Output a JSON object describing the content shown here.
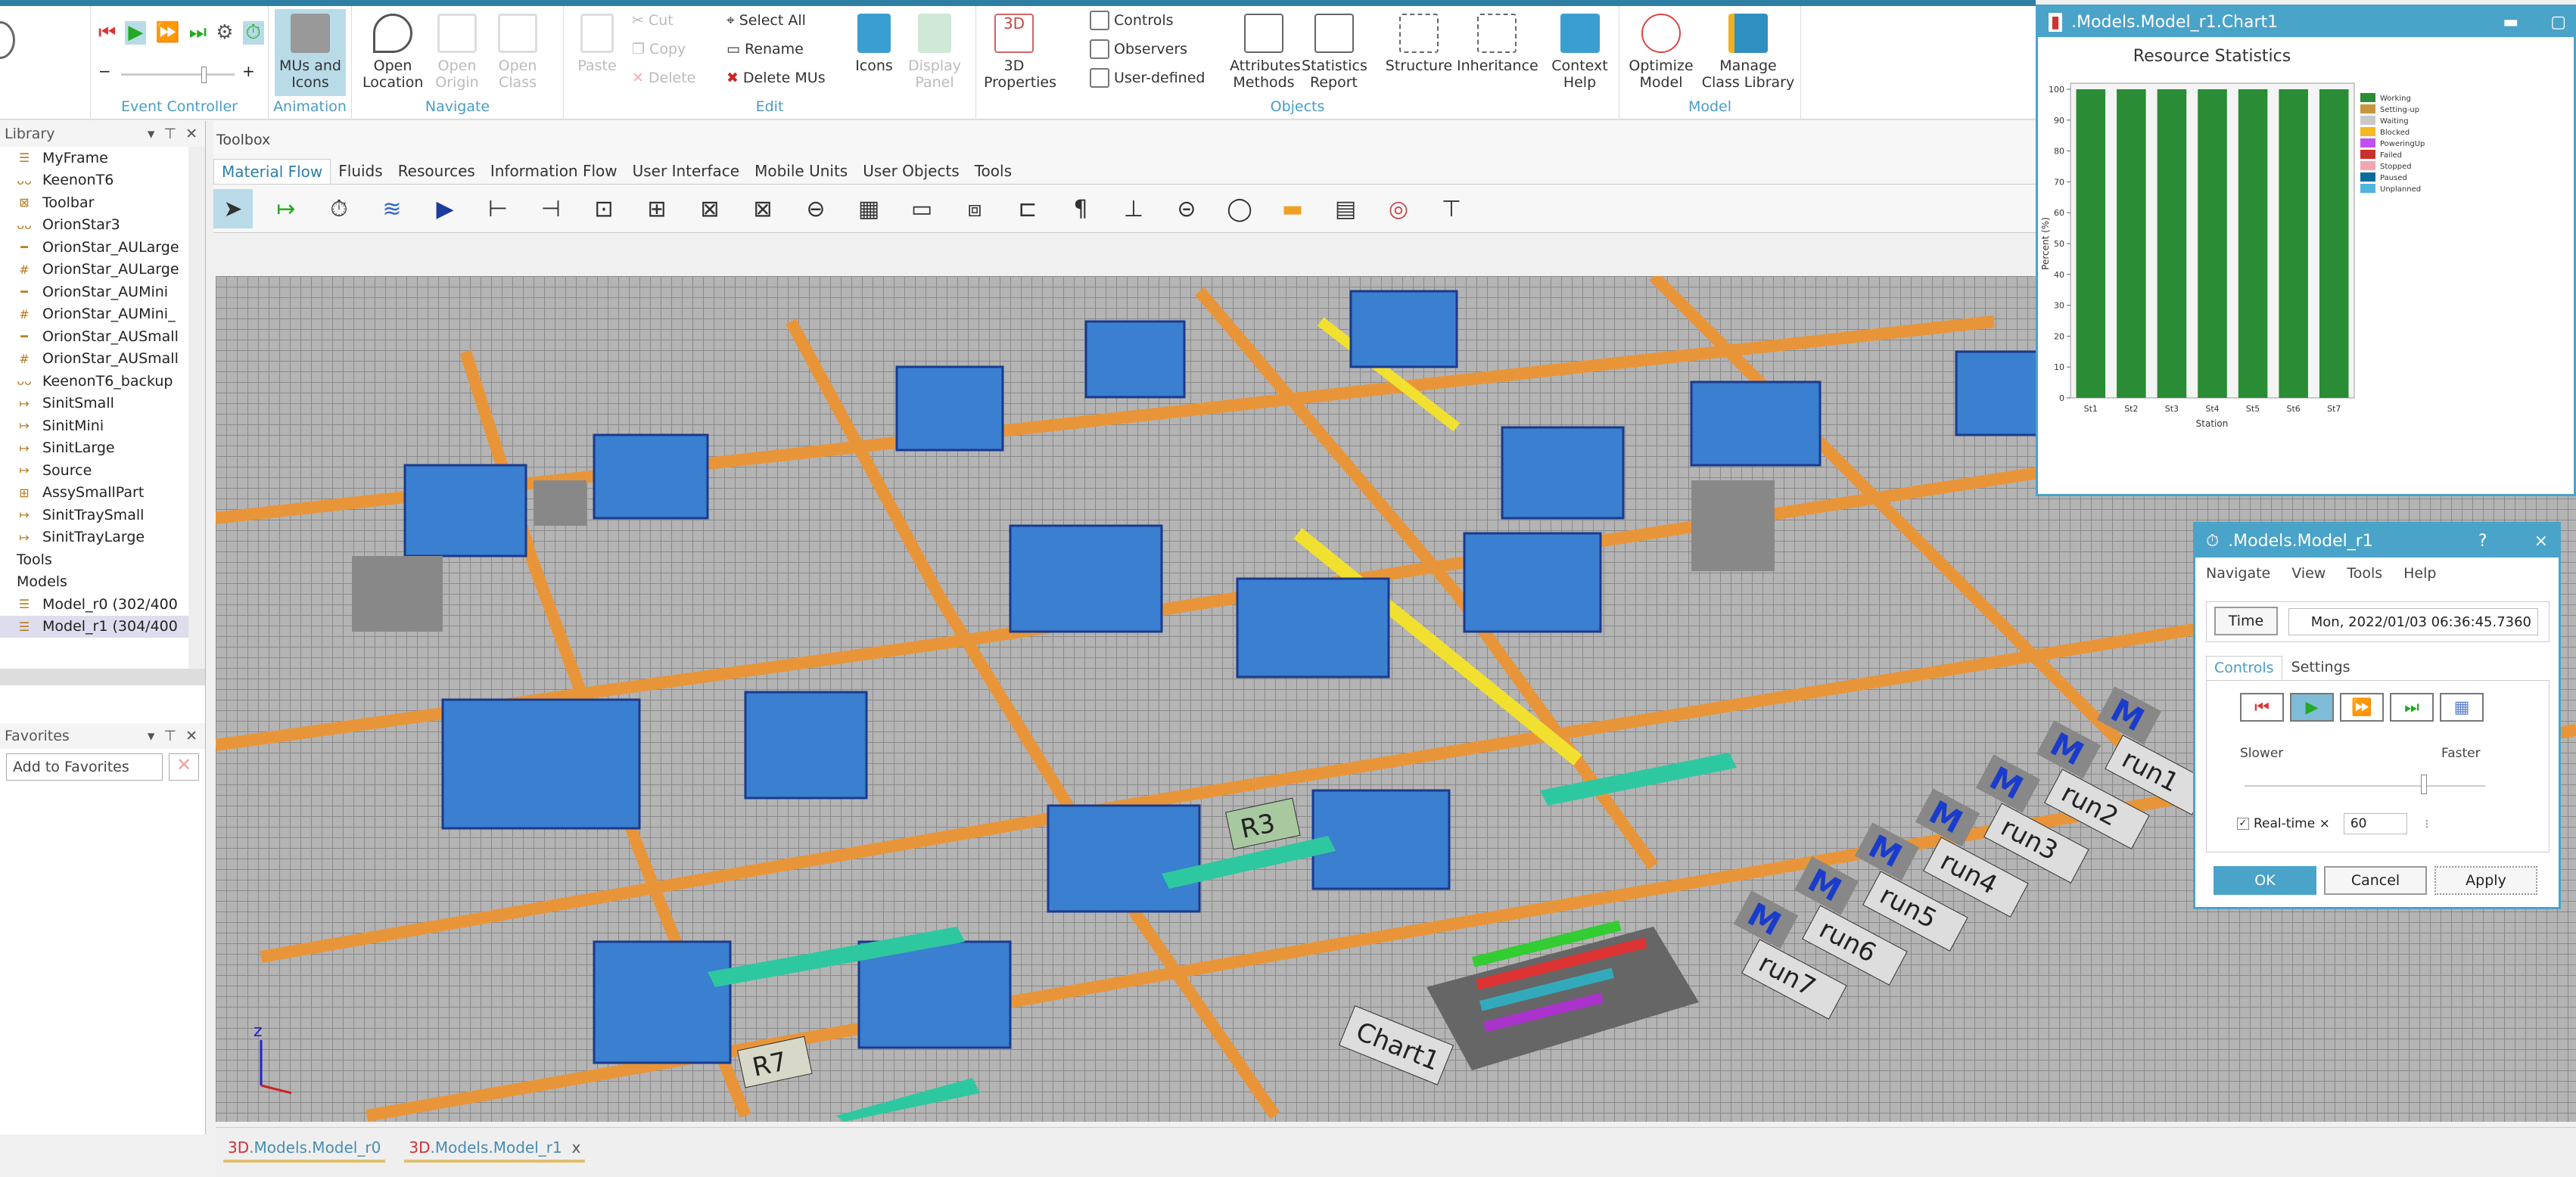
{
  "ribbon": {
    "event_controller": {
      "label": "Event Controller"
    },
    "animation": {
      "label": "Animation",
      "mus_icons": "MUs and Icons"
    },
    "navigate": {
      "label": "Navigate",
      "open_location": "Open Location",
      "open_origin": "Open Origin",
      "open_class": "Open Class"
    },
    "edit": {
      "label": "Edit",
      "paste": "Paste",
      "cut": "Cut",
      "copy": "Copy",
      "delete": "Delete",
      "select_all": "Select All",
      "rename": "Rename",
      "delete_mus": "Delete MUs",
      "icons": "Icons",
      "display_panel": "Display Panel"
    },
    "objects": {
      "label": "Objects",
      "props_3d": "3D Properties",
      "controls": "Controls",
      "observers": "Observers",
      "user_defined": "User-defined",
      "attributes_methods": "Attributes Methods",
      "statistics_report": "Statistics Report",
      "structure": "Structure",
      "inheritance": "Inheritance",
      "context_help": "Context Help"
    },
    "model": {
      "label": "Model",
      "optimize": "Optimize Model",
      "manage_library": "Manage Class Library"
    }
  },
  "library": {
    "title": "Library",
    "items": [
      {
        "label": "MyFrame",
        "icon": "frame-icon"
      },
      {
        "label": "KeenonT6",
        "icon": "robot-icon"
      },
      {
        "label": "Toolbar",
        "icon": "toolbar-icon"
      },
      {
        "label": "OrionStar3",
        "icon": "robot-icon"
      },
      {
        "label": "OrionStar_AULarge",
        "icon": "conveyor-icon"
      },
      {
        "label": "OrionStar_AULarge",
        "icon": "grid-icon"
      },
      {
        "label": "OrionStar_AUMini",
        "icon": "conveyor-icon"
      },
      {
        "label": "OrionStar_AUMini_",
        "icon": "grid-icon"
      },
      {
        "label": "OrionStar_AUSmall",
        "icon": "conveyor-icon"
      },
      {
        "label": "OrionStar_AUSmall",
        "icon": "grid-icon"
      },
      {
        "label": "KeenonT6_backup",
        "icon": "robot-icon"
      },
      {
        "label": "SinitSmall",
        "icon": "source-icon"
      },
      {
        "label": "SinitMini",
        "icon": "source-icon"
      },
      {
        "label": "SinitLarge",
        "icon": "source-icon"
      },
      {
        "label": "Source",
        "icon": "source-icon"
      },
      {
        "label": "AssySmallPart",
        "icon": "assembly-icon"
      },
      {
        "label": "SinitTraySmall",
        "icon": "source-icon"
      },
      {
        "label": "SinitTrayLarge",
        "icon": "source-icon"
      },
      {
        "label": "Tools",
        "icon": "folder-icon"
      },
      {
        "label": "Models",
        "icon": "folder-icon"
      },
      {
        "label": "Model_r0 (302/400",
        "icon": "frame-icon"
      },
      {
        "label": "Model_r1 (304/400",
        "icon": "frame-icon"
      }
    ]
  },
  "favorites": {
    "title": "Favorites",
    "add_button": "Add to Favorites"
  },
  "toolbox": {
    "title": "Toolbox",
    "tabs": [
      "Material Flow",
      "Fluids",
      "Resources",
      "Information Flow",
      "User Interface",
      "Mobile Units",
      "User Objects",
      "Tools"
    ]
  },
  "scene": {
    "labels": [
      "R7",
      "R3",
      "Chart1"
    ],
    "runs": [
      "run1",
      "run2",
      "run3",
      "run4",
      "run5",
      "run6",
      "run7"
    ],
    "method_glyph": "M"
  },
  "bottom_tabs": [
    {
      "prefix": "3D",
      "label": ".Models.Model_r0"
    },
    {
      "prefix": "3D",
      "label": ".Models.Model_r1",
      "close": "x"
    }
  ],
  "chart_window": {
    "title": ".Models.Model_r1.Chart1"
  },
  "chart_data": {
    "type": "bar",
    "stacked": true,
    "title": "Resource Statistics",
    "xlabel": "Station",
    "ylabel": "Percent (%)",
    "ylim": [
      0,
      100
    ],
    "yticks": [
      0,
      10,
      20,
      30,
      40,
      50,
      60,
      70,
      80,
      90,
      100
    ],
    "categories": [
      "St1",
      "St2",
      "St3",
      "St4",
      "St5",
      "St6",
      "St7"
    ],
    "legend_position": "right",
    "series": [
      {
        "name": "Working",
        "color": "#2a8c34",
        "values": [
          100,
          100,
          100,
          100,
          100,
          100,
          100
        ]
      },
      {
        "name": "Setting-up",
        "color": "#c8963c",
        "values": [
          0,
          0,
          0,
          0,
          0,
          0,
          0
        ]
      },
      {
        "name": "Waiting",
        "color": "#c8c8c8",
        "values": [
          0,
          0,
          0,
          0,
          0,
          0,
          0
        ]
      },
      {
        "name": "Blocked",
        "color": "#f5b820",
        "values": [
          0,
          0,
          0,
          0,
          0,
          0,
          0
        ]
      },
      {
        "name": "PoweringUp",
        "color": "#c050f0",
        "values": [
          0,
          0,
          0,
          0,
          0,
          0,
          0
        ]
      },
      {
        "name": "Failed",
        "color": "#c8302a",
        "values": [
          0,
          0,
          0,
          0,
          0,
          0,
          0
        ]
      },
      {
        "name": "Stopped",
        "color": "#f0a8b0",
        "values": [
          0,
          0,
          0,
          0,
          0,
          0,
          0
        ]
      },
      {
        "name": "Paused",
        "color": "#0a6c9c",
        "values": [
          0,
          0,
          0,
          0,
          0,
          0,
          0
        ]
      },
      {
        "name": "Unplanned",
        "color": "#50b4dc",
        "values": [
          0,
          0,
          0,
          0,
          0,
          0,
          0
        ]
      }
    ]
  },
  "dialog": {
    "title": ".Models.Model_r1",
    "help": "?",
    "close": "×",
    "menu": [
      "Navigate",
      "View",
      "Tools",
      "Help"
    ],
    "time_button": "Time",
    "time_value": "Mon, 2022/01/03 06:36:45.7360",
    "tabs": [
      "Controls",
      "Settings"
    ],
    "slower": "Slower",
    "faster": "Faster",
    "speed_fraction": 0.75,
    "realtime_checked": true,
    "realtime_label": "Real-time ×",
    "realtime_value": "60",
    "ok": "OK",
    "cancel": "Cancel",
    "apply": "Apply"
  },
  "colors": {
    "accent": "#4aa3c9",
    "path": "#e8953a"
  }
}
